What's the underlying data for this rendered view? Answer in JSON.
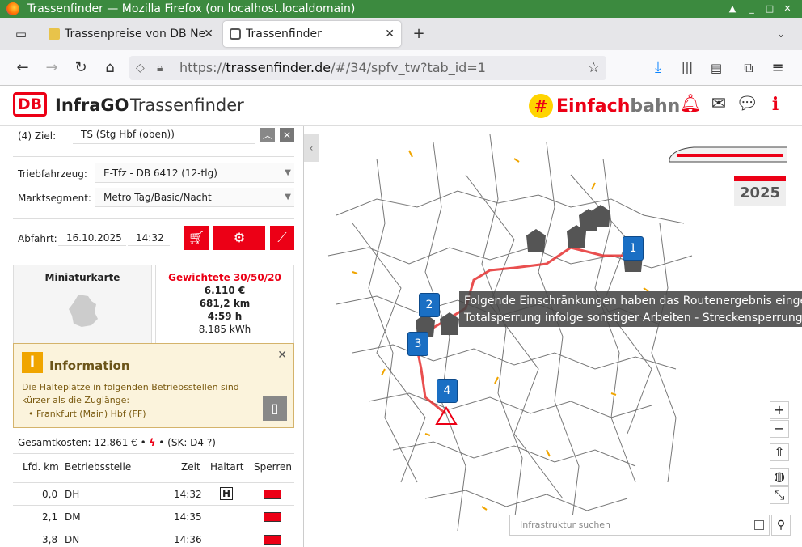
{
  "window": {
    "title": "Trassenfinder — Mozilla Firefox (on localhost.localdomain)"
  },
  "tabs": [
    {
      "label": "Trassenpreise von DB Ne"
    },
    {
      "label": "Trassenfinder"
    }
  ],
  "nav": {
    "url_prefix": "https://",
    "url_domain": "trassenfinder.de",
    "url_path": "/#/34/spfv_tw?tab_id=1"
  },
  "header": {
    "brand": "DB",
    "product": "InfraGO",
    "app": "Trassenfinder",
    "slogan_red": "Einfach",
    "slogan_grey": "bahn",
    "slogan_hash": "#"
  },
  "route": {
    "ziel_label": "(4) Ziel:",
    "ziel_value": "TS (Stg Hbf (oben))",
    "tfz_label": "Triebfahrzeug:",
    "tfz_value": "E-Tfz - DB 6412 (12-tlg)",
    "markt_label": "Marktsegment:",
    "markt_value": "Metro Tag/Basic/Nacht",
    "abfahrt_label": "Abfahrt:",
    "abfahrt_date": "16.10.2025",
    "abfahrt_time": "14:32"
  },
  "cards": {
    "mini_title": "Miniaturkarte",
    "weighted_title": "Gewichtete 30/50/20",
    "price": "6.110 €",
    "distance": "681,2 km",
    "duration": "4:59 h",
    "energy": "8.185 kWh"
  },
  "info": {
    "title": "Information",
    "text": "Die Halteplätze in folgenden Betriebsstellen sind kürzer als die Zuglänge:",
    "item": "• Frankfurt (Main) Hbf (FF)"
  },
  "summary": {
    "gesamt": "Gesamtkosten: 12.861 € •",
    "sk": "• (SK: D4 ?)"
  },
  "table": {
    "headers": [
      "Lfd. km",
      "Betriebsstelle",
      "Zeit",
      "Haltart",
      "Sperren"
    ],
    "rows": [
      {
        "km": "0,0",
        "bs": "DH",
        "zeit": "14:32",
        "halt": "H"
      },
      {
        "km": "2,1",
        "bs": "DM",
        "zeit": "14:35",
        "halt": ""
      },
      {
        "km": "3,8",
        "bs": "DN",
        "zeit": "14:36",
        "halt": ""
      }
    ]
  },
  "map": {
    "year_badge": "2025",
    "markers": [
      "1",
      "2",
      "3",
      "4"
    ],
    "tooltip_line1": "Folgende Einschränkungen haben das Routenergebnis eingeschr",
    "tooltip_line2": "Totalsperrung infolge sonstiger Arbeiten - Streckensperrung Spe",
    "search_placeholder": "Infrastruktur suchen",
    "zoom_in": "+",
    "zoom_out": "−"
  },
  "colors": {
    "db_red": "#ec0016",
    "firefox_green": "#3c8a3f",
    "marker_blue": "#1a6fc4"
  }
}
